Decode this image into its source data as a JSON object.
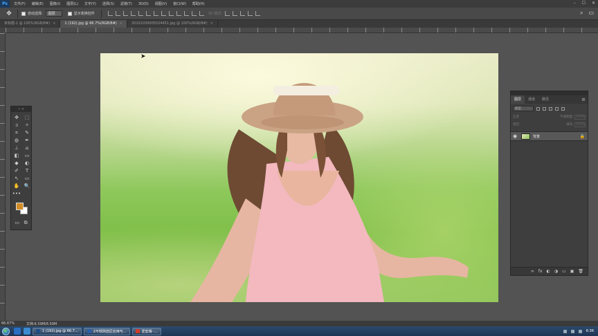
{
  "menu": {
    "app_logo": "Ps",
    "items": [
      "文件(F)",
      "编辑(E)",
      "图像(I)",
      "图层(L)",
      "文字(Y)",
      "选择(S)",
      "滤镜(T)",
      "3D(D)",
      "视图(V)",
      "窗口(W)",
      "帮助(H)"
    ],
    "window_controls": [
      "–",
      "☐",
      "✕"
    ]
  },
  "options": {
    "auto_select_label": "自动选择:",
    "auto_select_value": "图层",
    "show_transform_label": "显示变换控件",
    "mode_3d_label": "3D 模式:"
  },
  "tabs": [
    {
      "label": "未标题-1 @ 100%(RGB/8#)",
      "active": false
    },
    {
      "label": "1 (192).jpg @ 66.7%(RGB/8#)",
      "active": true
    },
    {
      "label": "20101030005524451.jpg @ 100%(RGB/8#)",
      "active": false
    }
  ],
  "tools": [
    "✥",
    "⬚",
    "ↄ",
    "✧",
    "⌗",
    "✎",
    "◍",
    "✒",
    "⊥",
    "⌂",
    "◧",
    "▭",
    "◆",
    "◐",
    "✐",
    "T",
    "↖",
    "▭",
    "✋",
    "🔍",
    "•••",
    ""
  ],
  "colors": {
    "foreground": "#d28d26",
    "background": "#ffffff"
  },
  "layers_panel": {
    "tabs": [
      "图层",
      "通道",
      "路径"
    ],
    "kind": "类型",
    "mode": "正常",
    "opacity_label": "不透明度:",
    "opacity": "100%",
    "lock_label": "锁定:",
    "fill_label": "填充:",
    "fill": "100%",
    "layer_name": "背景",
    "bottom_icons": [
      "∞",
      "fx",
      "◐",
      "◑",
      "▭",
      "▣",
      "🗑"
    ]
  },
  "status": {
    "zoom": "66.67%",
    "doc": "文档:6.59M/6.59M"
  },
  "taskbar": {
    "items": [
      "1 (192).jpg @ 66.7...",
      "2不规则选区应用与...",
      "爱剪辑 -..."
    ],
    "clock": "6:36"
  }
}
